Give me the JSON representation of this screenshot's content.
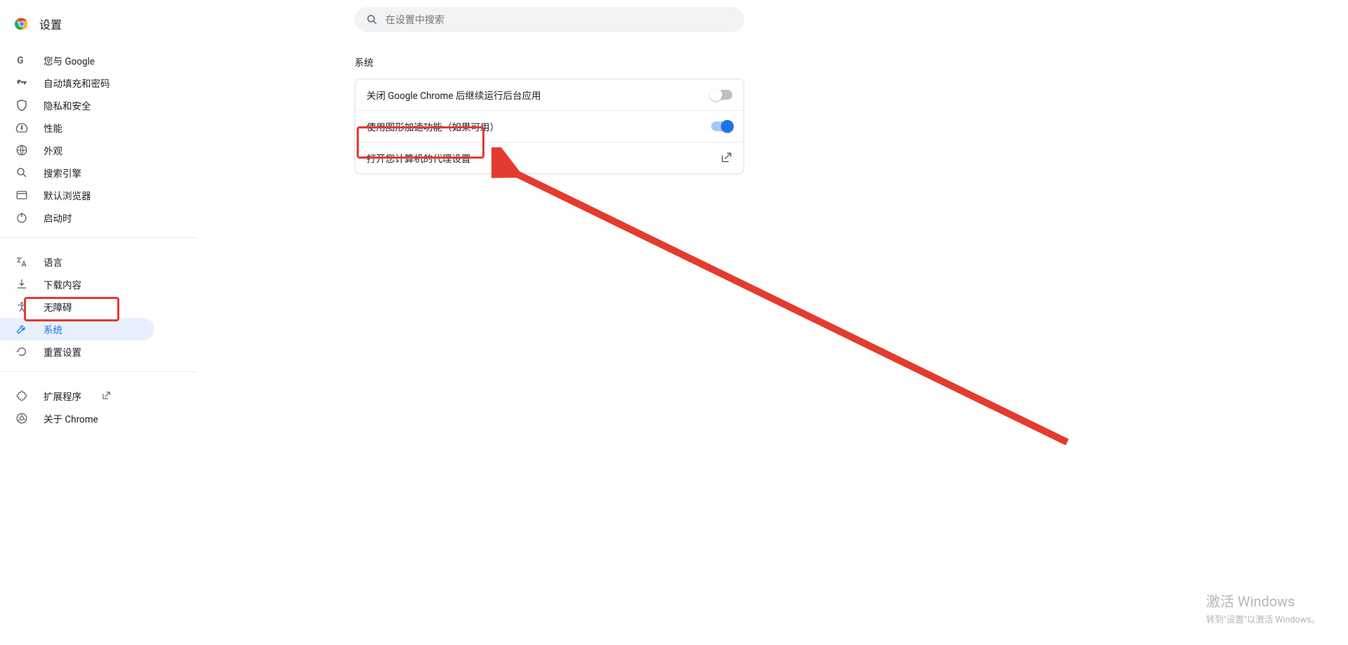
{
  "header": {
    "title": "设置"
  },
  "search": {
    "placeholder": "在设置中搜索"
  },
  "sidebar": {
    "items": [
      {
        "label": "您与 Google"
      },
      {
        "label": "自动填充和密码"
      },
      {
        "label": "隐私和安全"
      },
      {
        "label": "性能"
      },
      {
        "label": "外观"
      },
      {
        "label": "搜索引擎"
      },
      {
        "label": "默认浏览器"
      },
      {
        "label": "启动时"
      },
      {
        "label": "语言"
      },
      {
        "label": "下载内容"
      },
      {
        "label": "无障碍"
      },
      {
        "label": "系统"
      },
      {
        "label": "重置设置"
      },
      {
        "label": "扩展程序"
      },
      {
        "label": "关于 Chrome"
      }
    ]
  },
  "main": {
    "section_title": "系统",
    "rows": [
      {
        "label": "关闭 Google Chrome 后继续运行后台应用",
        "toggle": false
      },
      {
        "label": "使用图形加速功能（如果可用）",
        "toggle": true
      },
      {
        "label": "打开您计算机的代理设置"
      }
    ]
  },
  "watermark": {
    "line1": "激活 Windows",
    "line2": "转到\"设置\"以激活 Windows。"
  }
}
